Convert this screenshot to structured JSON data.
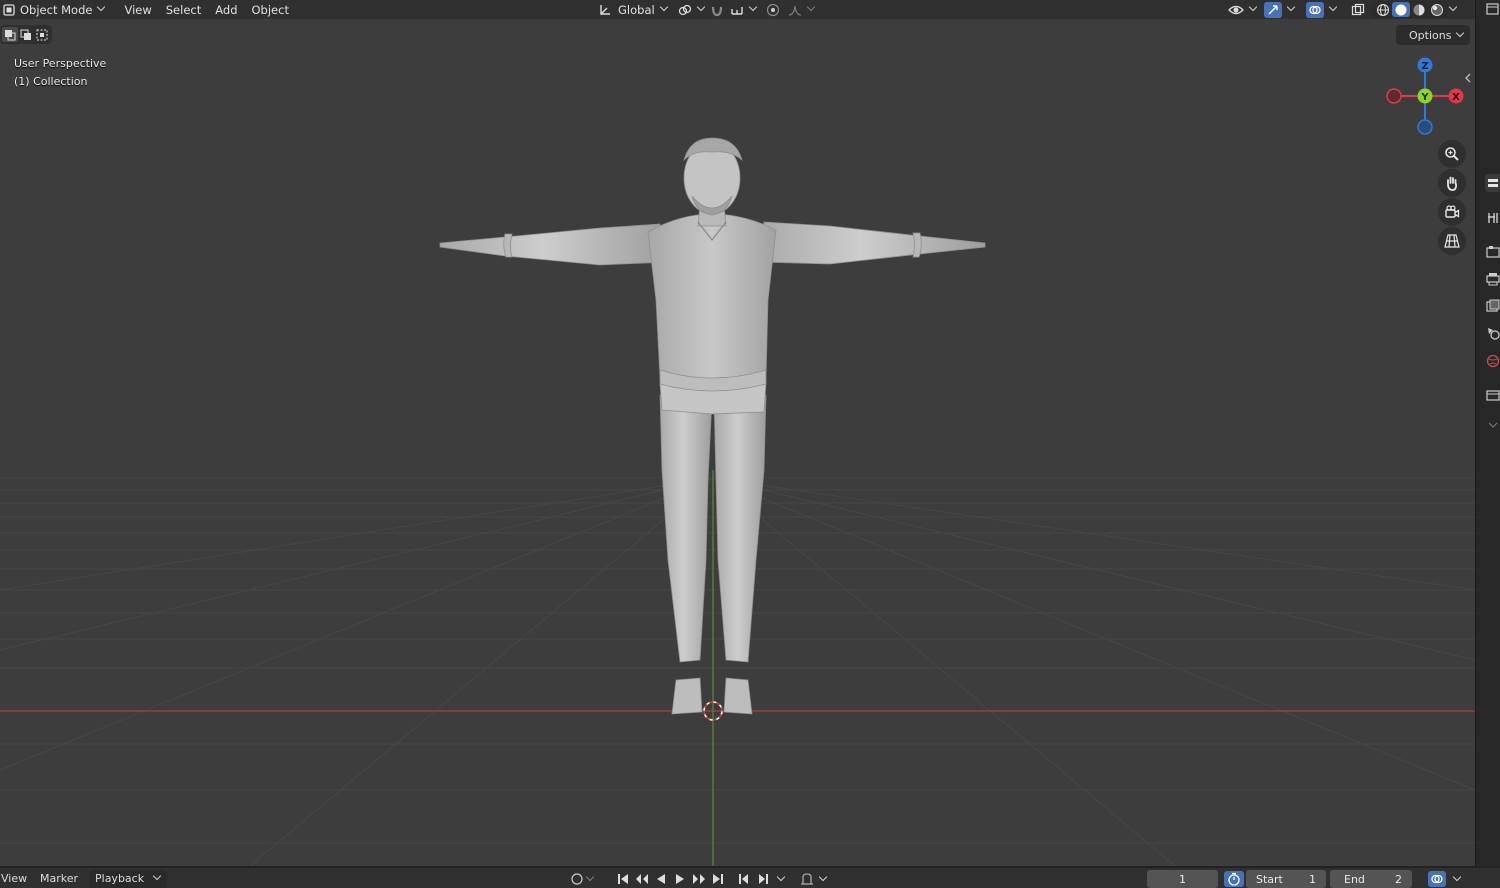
{
  "header": {
    "mode": "Object Mode",
    "menus": [
      "View",
      "Select",
      "Add",
      "Object"
    ],
    "transform_orientation": "Global",
    "options_label": "Options"
  },
  "viewport": {
    "view_name": "User Perspective",
    "collection": "(1) Collection",
    "background": "#3d3d3d",
    "object": "human figure in T-pose, sweater and trousers, sneakers",
    "axis_x_color": "#d2394b",
    "axis_y_color": "#6ea23a"
  },
  "gizmo": {
    "z_label": "Z",
    "y_label": "Y",
    "x_label": "X",
    "colors": {
      "x": "#e0394b",
      "y": "#8bd42c",
      "z": "#2d7ad8"
    }
  },
  "nav_icons": [
    "zoom-icon",
    "pan-hand-icon",
    "camera-view-icon",
    "ortho-grid-icon"
  ],
  "properties_tabs": [
    "tool-tab",
    "render-tab",
    "output-tab",
    "view-layer-tab",
    "scene-tab",
    "world-tab",
    "collection-tab",
    "expand-tab"
  ],
  "timeline": {
    "menus": [
      "View",
      "Marker",
      "Playback"
    ],
    "current_frame": "1",
    "start_label": "Start",
    "start_value": "1",
    "end_label": "End",
    "end_value": "2"
  }
}
